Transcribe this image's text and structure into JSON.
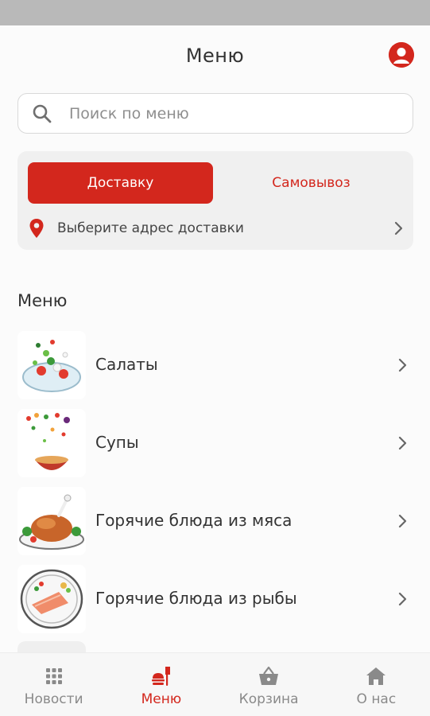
{
  "header": {
    "title": "Меню",
    "profile_icon": "profile-icon"
  },
  "search": {
    "placeholder": "Поиск по меню",
    "icon": "search-icon"
  },
  "delivery": {
    "tabs": [
      {
        "label": "Доставку",
        "active": true
      },
      {
        "label": "Самовывоз",
        "active": false
      }
    ],
    "address_placeholder": "Выберите адрес доставки"
  },
  "menu": {
    "section_title": "Меню",
    "items": [
      {
        "label": "Салаты",
        "icon": "salad-image"
      },
      {
        "label": "Супы",
        "icon": "soup-image"
      },
      {
        "label": "Горячие блюда из мяса",
        "icon": "meat-dish-image"
      },
      {
        "label": "Горячие блюда из рыбы",
        "icon": "fish-dish-image"
      }
    ]
  },
  "bottom_nav": [
    {
      "label": "Новости",
      "icon": "grid-icon",
      "active": false
    },
    {
      "label": "Меню",
      "icon": "menu-food-icon",
      "active": true
    },
    {
      "label": "Корзина",
      "icon": "basket-icon",
      "active": false
    },
    {
      "label": "О нас",
      "icon": "home-icon",
      "active": false
    }
  ],
  "colors": {
    "accent": "#d3271d",
    "inactive": "#8a8a8a",
    "background": "#fbfbfb"
  }
}
